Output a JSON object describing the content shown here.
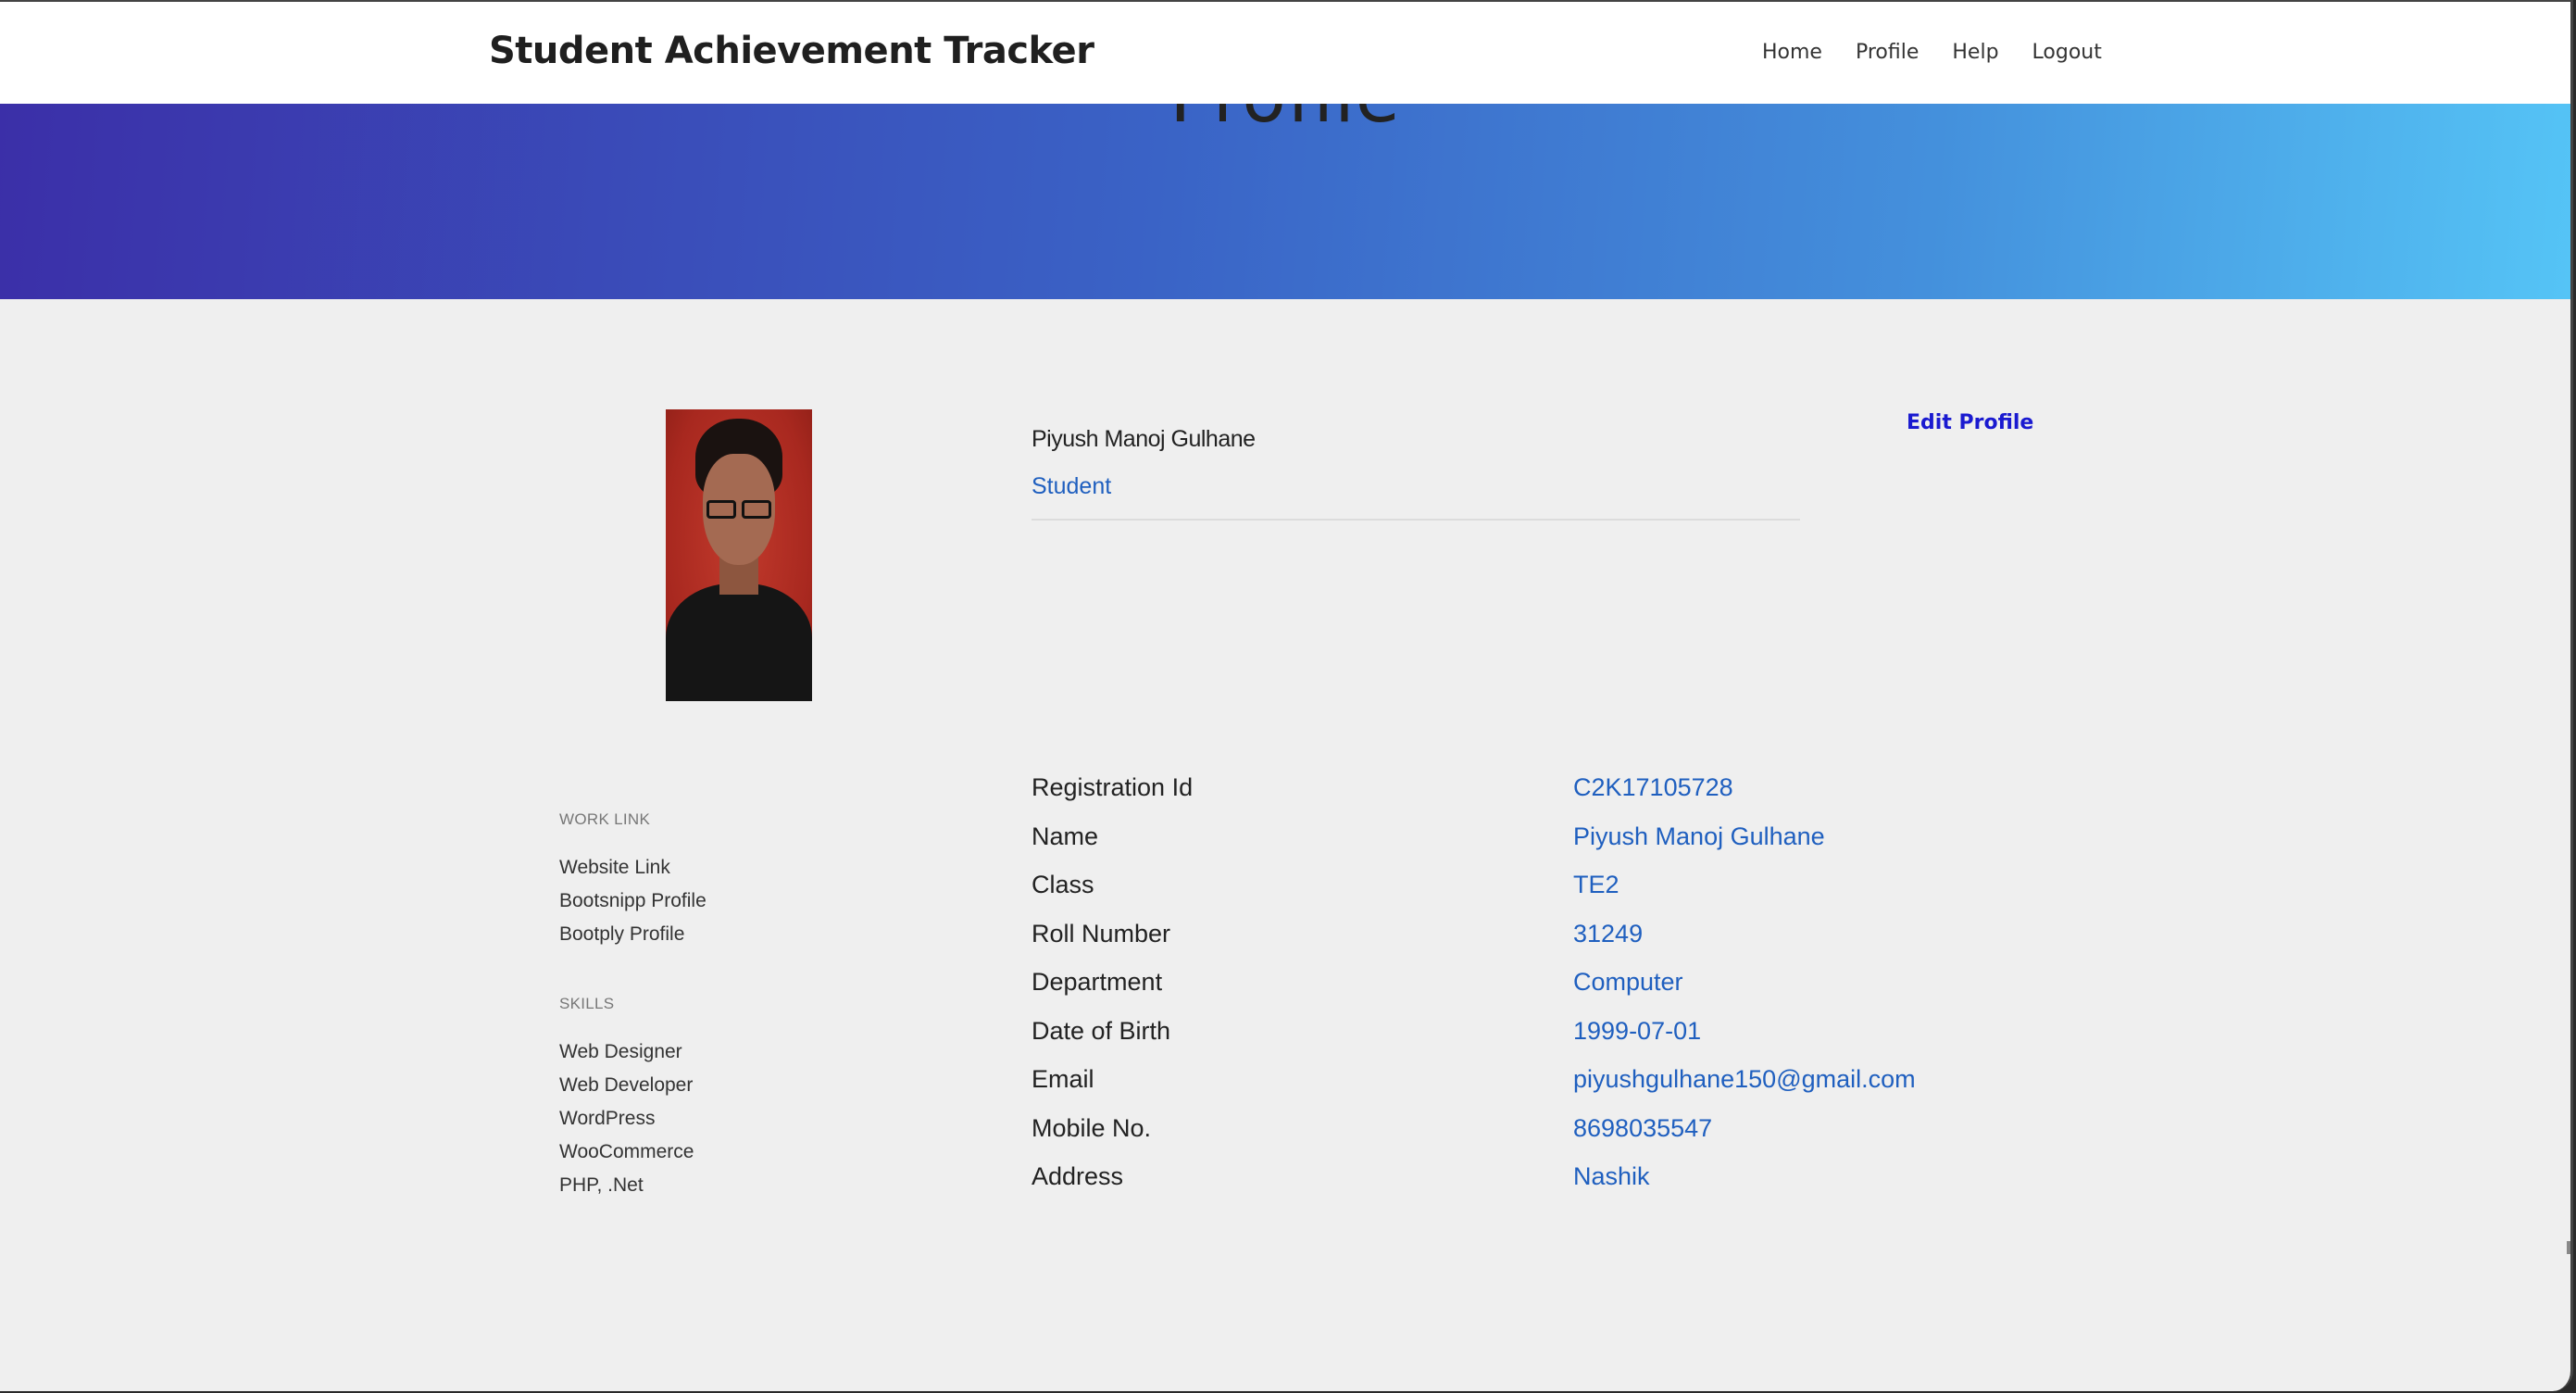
{
  "navbar": {
    "brand": "Student Achievement Tracker",
    "links": [
      "Home",
      "Profile",
      "Help",
      "Logout"
    ]
  },
  "hero": {
    "title": "Profile"
  },
  "profile": {
    "name": "Piyush Manoj Gulhane",
    "role": "Student",
    "edit_label": "Edit Profile"
  },
  "sidebar": {
    "work_link_title": "WORK LINK",
    "work_links": [
      "Website Link",
      "Bootsnipp Profile",
      "Bootply Profile"
    ],
    "skills_title": "SKILLS",
    "skills": [
      "Web Designer",
      "Web Developer",
      "WordPress",
      "WooCommerce",
      "PHP, .Net"
    ]
  },
  "details": [
    {
      "label": "Registration Id",
      "value": "C2K17105728"
    },
    {
      "label": "Name",
      "value": "Piyush Manoj Gulhane"
    },
    {
      "label": "Class",
      "value": "TE2"
    },
    {
      "label": "Roll Number",
      "value": "31249"
    },
    {
      "label": "Department",
      "value": "Computer"
    },
    {
      "label": "Date of Birth",
      "value": "1999-07-01"
    },
    {
      "label": "Email",
      "value": "piyushgulhane150@gmail.com"
    },
    {
      "label": "Mobile No.",
      "value": "8698035547"
    },
    {
      "label": "Address",
      "value": "Nashik"
    }
  ],
  "colors": {
    "gradient_start": "#3b2fa8",
    "gradient_end": "#55c4f6",
    "link_blue": "#1f5fbf",
    "edit_blue": "#1a1ad0"
  }
}
